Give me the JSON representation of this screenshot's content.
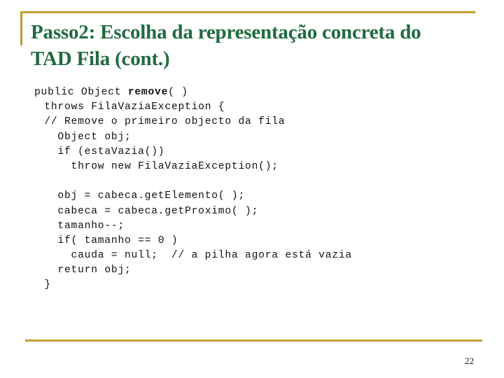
{
  "slide": {
    "title_line1": "Passo2: Escolha da representação concreta do",
    "title_line2": "TAD Fila (cont.)",
    "page_number": "22",
    "accent_color": "#BE9F2E",
    "title_color": "#1F6B3F"
  },
  "code": {
    "lines": [
      {
        "indent": 0,
        "pre": "public Object ",
        "bold": "remove",
        "post": "( )"
      },
      {
        "indent": 1.5,
        "text": "throws FilaVaziaException {"
      },
      {
        "indent": 1.5,
        "text": "// Remove o primeiro objecto da fila"
      },
      {
        "indent": 3.5,
        "text": "Object obj;"
      },
      {
        "indent": 3.5,
        "text": "if (estaVazia())"
      },
      {
        "indent": 5.5,
        "text": "throw new FilaVaziaException();"
      },
      {
        "indent": 0,
        "text": ""
      },
      {
        "indent": 3.5,
        "text": "obj = cabeca.getElemento( );"
      },
      {
        "indent": 3.5,
        "text": "cabeca = cabeca.getProximo( );"
      },
      {
        "indent": 3.5,
        "text": "tamanho--;"
      },
      {
        "indent": 3.5,
        "text": "if( tamanho == 0 )"
      },
      {
        "indent": 5.5,
        "text": "cauda = null;  // a pilha agora está vazia"
      },
      {
        "indent": 3.5,
        "text": "return obj;"
      },
      {
        "indent": 1.5,
        "text": "}"
      }
    ]
  }
}
